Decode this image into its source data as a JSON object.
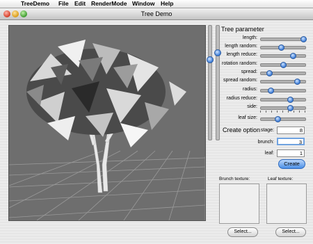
{
  "menubar": {
    "app_name": "TreeDemo",
    "items": [
      "File",
      "Edit",
      "RenderMode",
      "Window",
      "Help"
    ]
  },
  "window": {
    "title": "Tree Demo"
  },
  "tree_parameter": {
    "title": "Tree parameter",
    "sliders": [
      {
        "label": "length:",
        "value": 0.95
      },
      {
        "label": "length random:",
        "value": 0.45
      },
      {
        "label": "length reduce:",
        "value": 0.72
      },
      {
        "label": "rotation random:",
        "value": 0.5
      },
      {
        "label": "spread:",
        "value": 0.18
      },
      {
        "label": "spread random:",
        "value": 0.82
      },
      {
        "label": "radius:",
        "value": 0.22
      },
      {
        "label": "radius reduce:",
        "value": 0.65
      },
      {
        "label": "side:",
        "value": 0.65
      },
      {
        "label": "leaf size:",
        "value": 0.38
      }
    ]
  },
  "create_option": {
    "title": "Create option",
    "stage_label": "stage:",
    "stage_value": "8",
    "brunch_label": "brunch:",
    "brunch_value": "3",
    "leaf_label": "leaf:",
    "leaf_value": "1",
    "create_button": "Create"
  },
  "textures": {
    "brunch_label": "Brunch texture:",
    "leaf_label": "Leaf texture:",
    "select_button": "Select..."
  },
  "colors": {
    "viewport_bg": "#6e6e6e",
    "accent": "#3d7dd8"
  }
}
